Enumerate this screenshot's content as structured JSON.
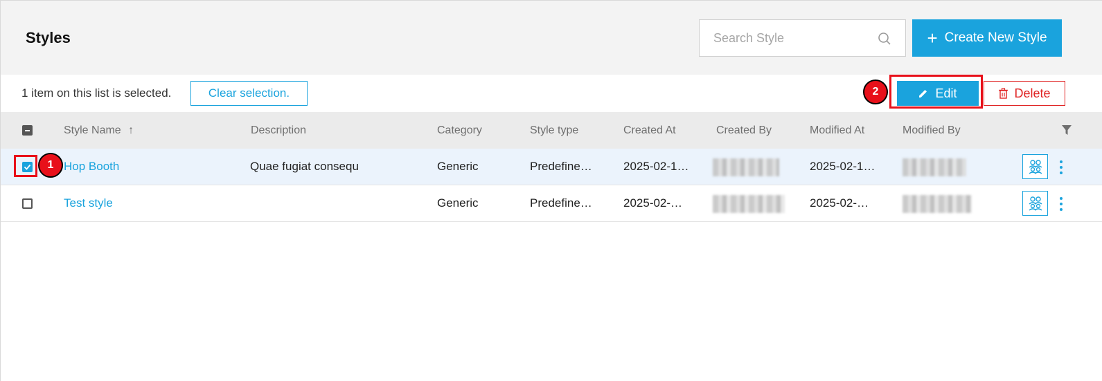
{
  "header": {
    "title": "Styles",
    "search_placeholder": "Search Style",
    "create_label": "Create New Style"
  },
  "selection_bar": {
    "message": "1 item on this list is selected.",
    "clear_label": "Clear selection.",
    "edit_label": "Edit",
    "delete_label": "Delete"
  },
  "table": {
    "columns": [
      "Style Name",
      "Description",
      "Category",
      "Style type",
      "Created At",
      "Created By",
      "Modified At",
      "Modified By"
    ],
    "sort_indicator": "↑",
    "rows": [
      {
        "name": "Hop Booth",
        "description": "Quae fugiat consequ",
        "category": "Generic",
        "style_type": "Predefine…",
        "created_at": "2025-02-1…",
        "modified_at": "2025-02-1…",
        "selected": true
      },
      {
        "name": "Test style",
        "description": "",
        "category": "Generic",
        "style_type": "Predefine…",
        "created_at": "2025-02-…",
        "modified_at": "2025-02-…",
        "selected": false
      }
    ]
  },
  "annotations": {
    "step1": "1",
    "step2": "2"
  },
  "colors": {
    "accent": "#1aa3dd",
    "danger": "#e02424",
    "annotation": "#e8101a",
    "selected_row": "#ebf3fc"
  },
  "icons": [
    "search-icon",
    "plus-icon",
    "pencil-icon",
    "trash-icon",
    "sort-up-icon",
    "filter-icon",
    "people-icon",
    "kebab-icon",
    "check-icon"
  ]
}
